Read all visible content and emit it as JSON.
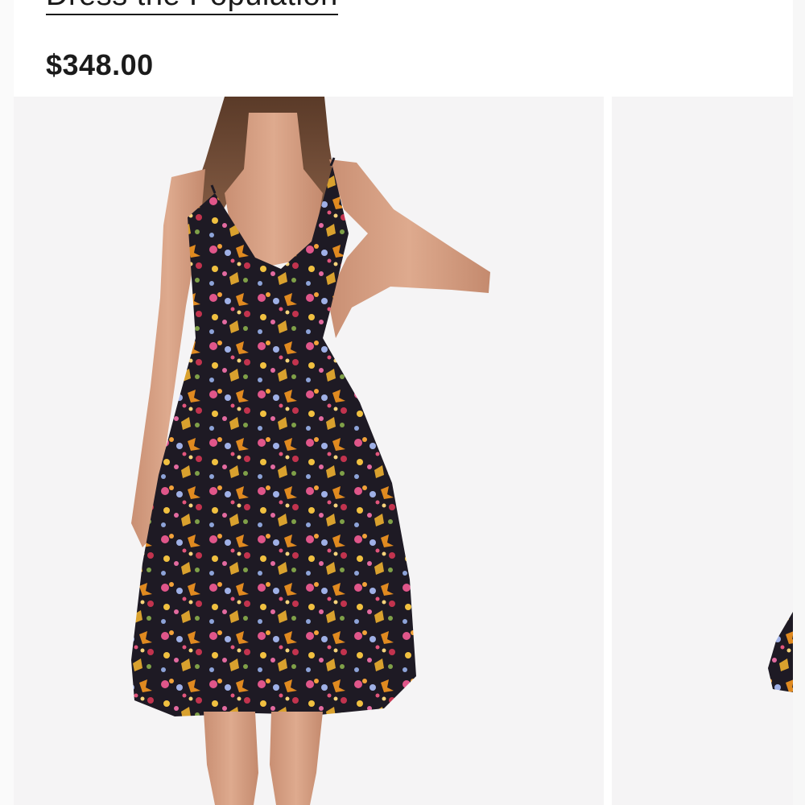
{
  "product": {
    "brand": "Dress the Population",
    "price": "$348.00"
  },
  "gallery": {
    "main_image_label": "product-photo-dress-front",
    "next_image_label": "product-photo-dress-alternate"
  },
  "colors": {
    "background": "#ffffff",
    "text": "#1b1b1b",
    "image_bg": "#f5f4f5",
    "dress_base": "#1e1a24"
  }
}
